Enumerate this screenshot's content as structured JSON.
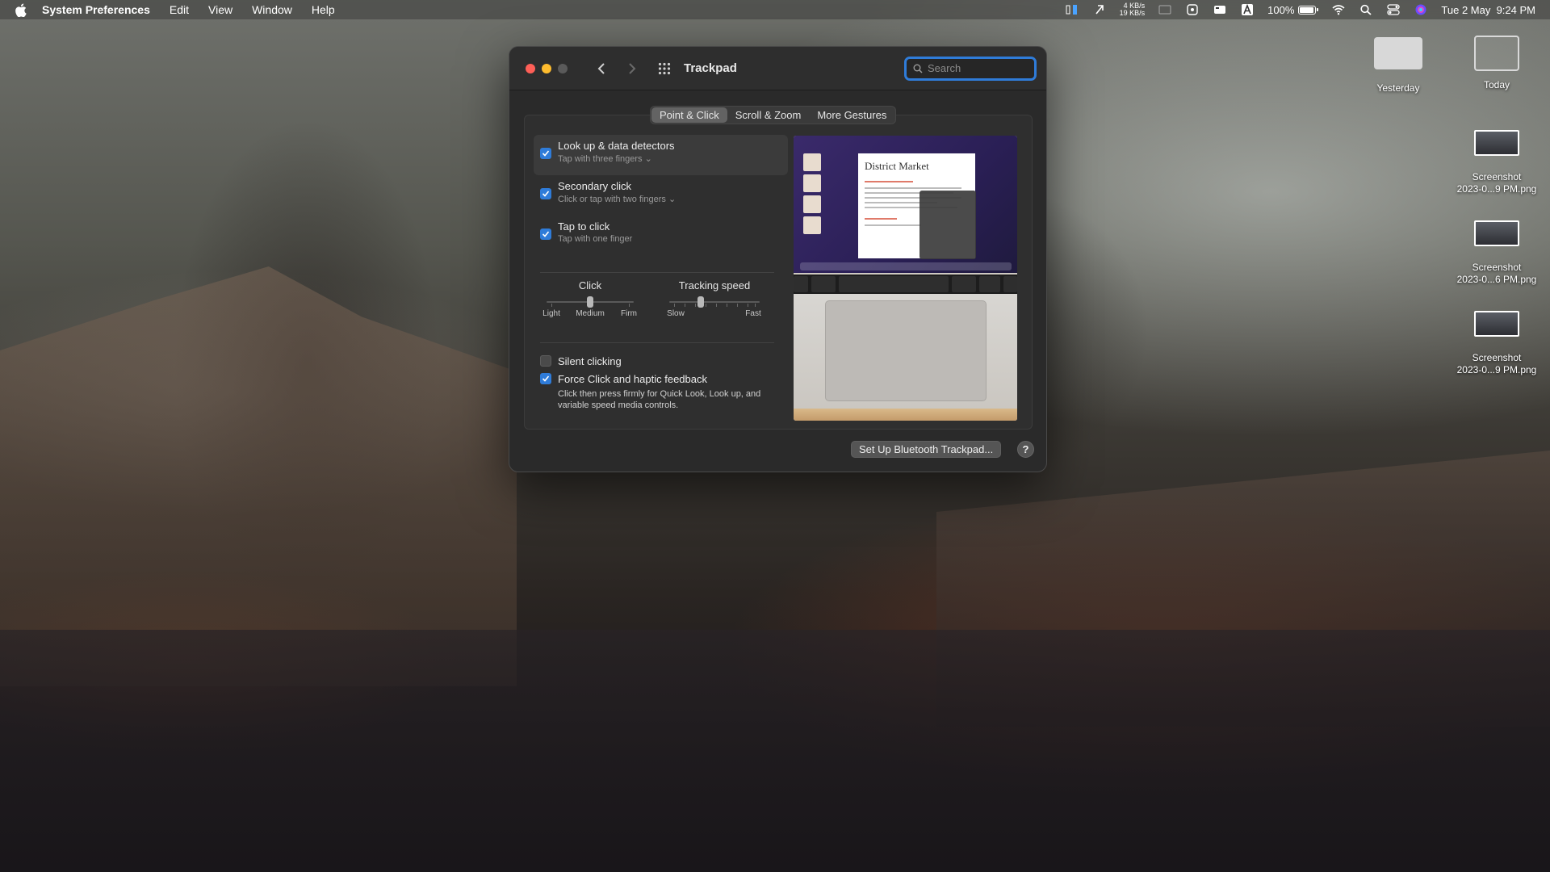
{
  "menubar": {
    "app_name": "System Preferences",
    "menus": [
      "Edit",
      "View",
      "Window",
      "Help"
    ],
    "net_up": "4 KB/s",
    "net_down": "19 KB/s",
    "battery_percent": "100%",
    "battery_level": 1.0,
    "datetime": "Tue 2 May  9:24 PM"
  },
  "window": {
    "title": "Trackpad",
    "search_placeholder": "Search",
    "tabs": [
      {
        "label": "Point & Click",
        "active": true
      },
      {
        "label": "Scroll & Zoom",
        "active": false
      },
      {
        "label": "More Gestures",
        "active": false
      }
    ],
    "options": [
      {
        "title": "Look up & data detectors",
        "subtitle": "Tap with three fingers",
        "checked": true,
        "dropdown": true
      },
      {
        "title": "Secondary click",
        "subtitle": "Click or tap with two fingers",
        "checked": true,
        "dropdown": true
      },
      {
        "title": "Tap to click",
        "subtitle": "Tap with one finger",
        "checked": true,
        "dropdown": false
      }
    ],
    "click_slider": {
      "title": "Click",
      "labels": [
        "Light",
        "Medium",
        "Firm"
      ],
      "value": 0.5
    },
    "tracking_slider": {
      "title": "Tracking speed",
      "labels": [
        "Slow",
        "Fast"
      ],
      "value": 0.33
    },
    "silent_clicking": {
      "label": "Silent clicking",
      "checked": false
    },
    "force_click": {
      "label": "Force Click and haptic feedback",
      "checked": true,
      "description": "Click then press firmly for Quick Look, Look up, and variable speed media controls."
    },
    "preview_doc_title": "District Market",
    "bluetooth_button": "Set Up Bluetooth Trackpad...",
    "help_button": "?"
  },
  "desktop": [
    {
      "label": "Yesterday"
    },
    {
      "label": "Today"
    },
    {
      "label": "Screenshot\n2023-0...9 PM.png"
    },
    {
      "label": "Screenshot\n2023-0...6 PM.png"
    },
    {
      "label": "Screenshot\n2023-0...9 PM.png"
    }
  ]
}
